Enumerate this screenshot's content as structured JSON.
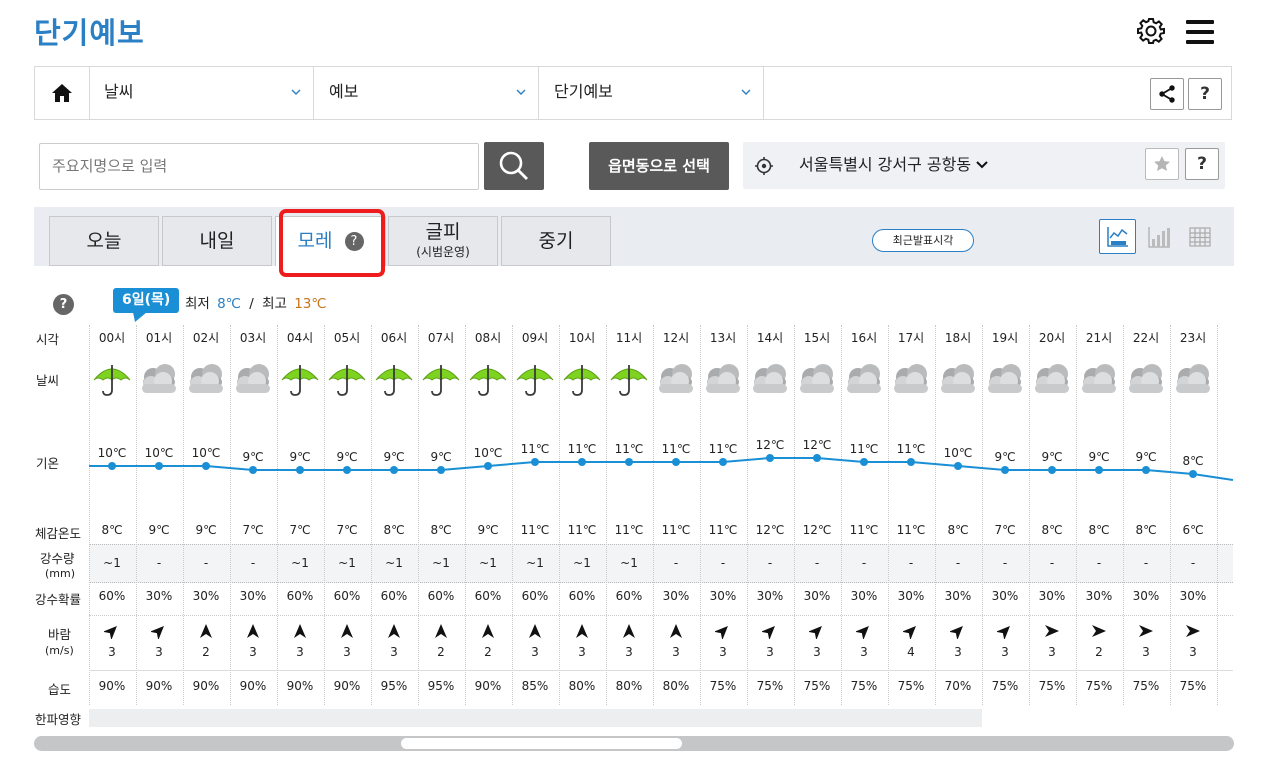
{
  "header": {
    "title": "단기예보"
  },
  "breadcrumb": {
    "items": [
      {
        "label": "날씨"
      },
      {
        "label": "예보"
      },
      {
        "label": "단기예보"
      }
    ],
    "help_label": "?"
  },
  "search": {
    "placeholder": "주요지명으로 입력",
    "region_button": "읍면동으로 선택",
    "location": "서울특별시 강서구 공항동",
    "help_label": "?"
  },
  "tabs": [
    {
      "label": "오늘"
    },
    {
      "label": "내일"
    },
    {
      "label": "모레",
      "badge": "?"
    },
    {
      "label": "글피",
      "sub": "(시범운영)"
    },
    {
      "label": "중기"
    }
  ],
  "recent_button": "최근발표시각",
  "day": {
    "help_label": "?",
    "date_label": "6일(목)",
    "min_label": "최저",
    "min_value": "8℃",
    "separator": "/",
    "max_label": "최고",
    "max_value": "13℃"
  },
  "row_labels": {
    "time": "시각",
    "weather": "날씨",
    "temp": "기온",
    "feels": "체감온도",
    "precip": "강수량",
    "precip_unit": "(mm)",
    "prob": "강수확률",
    "wind": "바람",
    "wind_unit": "(m/s)",
    "humidity": "습도",
    "cold": "한파영향"
  },
  "forecast": {
    "hours": [
      "00시",
      "01시",
      "02시",
      "03시",
      "04시",
      "05시",
      "06시",
      "07시",
      "08시",
      "09시",
      "10시",
      "11시",
      "12시",
      "13시",
      "14시",
      "15시",
      "16시",
      "17시",
      "18시",
      "19시",
      "20시",
      "21시",
      "22시",
      "23시"
    ],
    "weather": [
      "rain",
      "cloudy",
      "cloudy",
      "cloudy",
      "rain",
      "rain",
      "rain",
      "rain",
      "rain",
      "rain",
      "rain",
      "rain",
      "cloudy",
      "cloudy",
      "cloudy",
      "cloudy",
      "cloudy",
      "cloudy",
      "cloudy",
      "cloudy",
      "cloudy",
      "cloudy",
      "cloudy",
      "cloudy"
    ],
    "temp": [
      10,
      10,
      10,
      9,
      9,
      9,
      9,
      9,
      10,
      11,
      11,
      11,
      11,
      11,
      12,
      12,
      11,
      11,
      10,
      9,
      9,
      9,
      9,
      8
    ],
    "temp_labels": [
      "10℃",
      "10℃",
      "10℃",
      "9℃",
      "9℃",
      "9℃",
      "9℃",
      "9℃",
      "10℃",
      "11℃",
      "11℃",
      "11℃",
      "11℃",
      "11℃",
      "12℃",
      "12℃",
      "11℃",
      "11℃",
      "10℃",
      "9℃",
      "9℃",
      "9℃",
      "9℃",
      "8℃"
    ],
    "feels": [
      "8℃",
      "9℃",
      "9℃",
      "7℃",
      "7℃",
      "7℃",
      "8℃",
      "8℃",
      "9℃",
      "11℃",
      "11℃",
      "11℃",
      "11℃",
      "11℃",
      "12℃",
      "12℃",
      "11℃",
      "11℃",
      "8℃",
      "7℃",
      "8℃",
      "8℃",
      "8℃",
      "6℃"
    ],
    "precip": [
      "~1",
      "-",
      "-",
      "-",
      "~1",
      "~1",
      "~1",
      "~1",
      "~1",
      "~1",
      "~1",
      "~1",
      "-",
      "-",
      "-",
      "-",
      "-",
      "-",
      "-",
      "-",
      "-",
      "-",
      "-",
      "-"
    ],
    "prob": [
      "60%",
      "30%",
      "30%",
      "30%",
      "60%",
      "60%",
      "60%",
      "60%",
      "60%",
      "60%",
      "60%",
      "60%",
      "30%",
      "30%",
      "30%",
      "30%",
      "30%",
      "30%",
      "30%",
      "30%",
      "30%",
      "30%",
      "30%",
      "30%"
    ],
    "wind_dir": [
      "sw",
      "sw",
      "s",
      "s",
      "s",
      "s",
      "s",
      "s",
      "s",
      "s",
      "s",
      "s",
      "s",
      "sw",
      "sw",
      "sw",
      "sw",
      "sw",
      "sw",
      "sw",
      "w",
      "w",
      "w",
      "w"
    ],
    "wind": [
      "3",
      "3",
      "2",
      "3",
      "3",
      "3",
      "3",
      "2",
      "2",
      "3",
      "3",
      "3",
      "3",
      "3",
      "3",
      "3",
      "3",
      "4",
      "3",
      "3",
      "3",
      "2",
      "3",
      "3"
    ],
    "humidity": [
      "90%",
      "90%",
      "90%",
      "90%",
      "90%",
      "90%",
      "95%",
      "95%",
      "90%",
      "85%",
      "80%",
      "80%",
      "80%",
      "75%",
      "75%",
      "75%",
      "75%",
      "75%",
      "70%",
      "75%",
      "75%",
      "75%",
      "75%",
      "75%"
    ]
  },
  "colors": {
    "accent": "#2b7fc4",
    "min_temp": "#2b7fc4",
    "max_temp": "#c8731c",
    "temp_line": "#1a8fd6",
    "highlight": "#ee1c1c"
  }
}
